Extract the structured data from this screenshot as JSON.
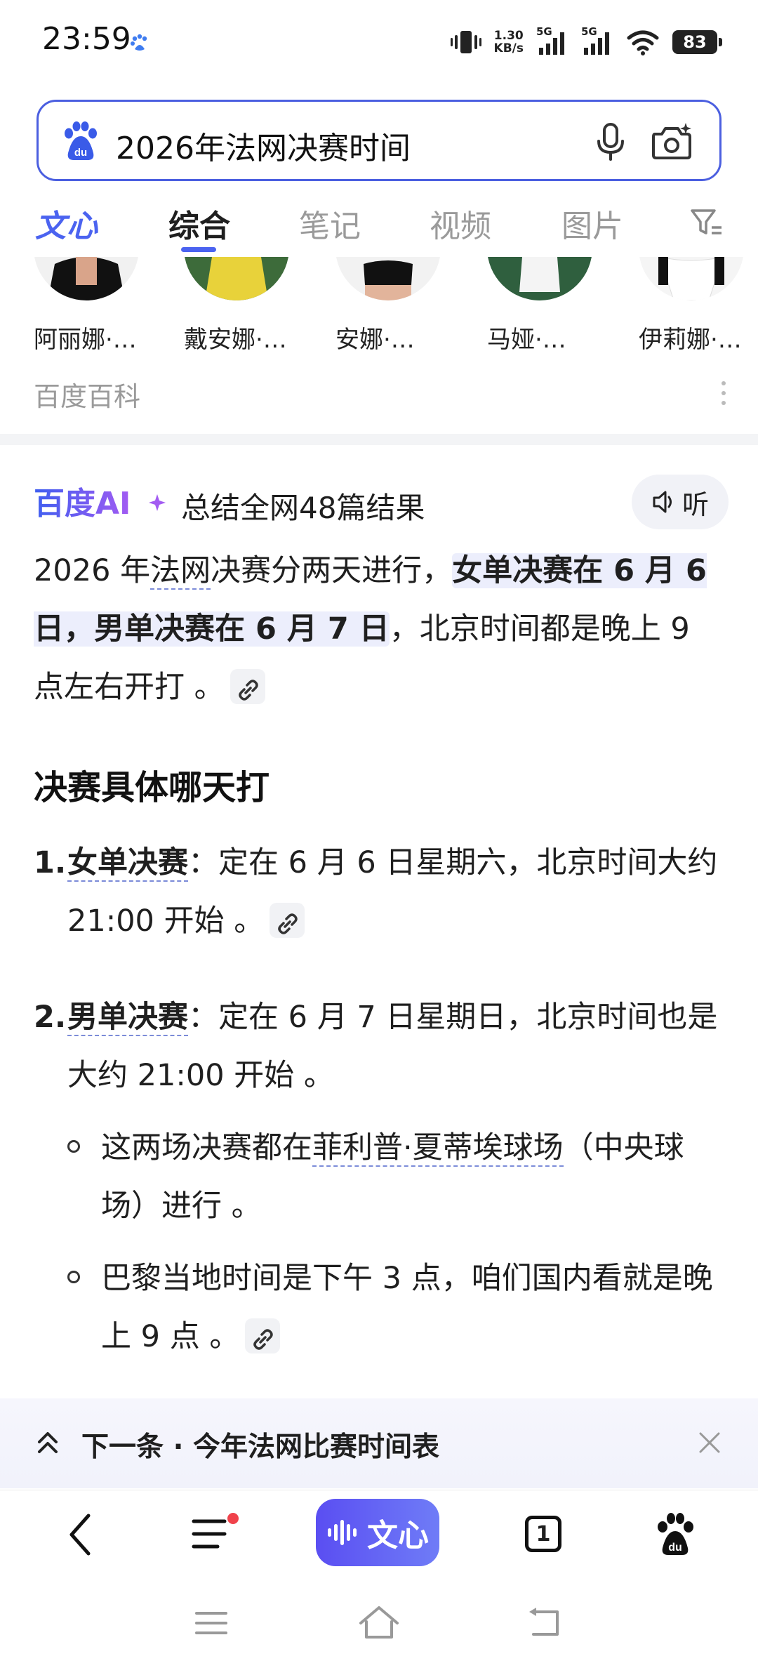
{
  "status_bar": {
    "time": "23:59",
    "net_speed_value": "1.30",
    "net_speed_unit": "KB/s",
    "signal1_label": "5G",
    "signal2_label": "5G",
    "battery_level": "83"
  },
  "search": {
    "query": "2026年法网决赛时间"
  },
  "tabs": [
    {
      "label": "文心"
    },
    {
      "label": "综合"
    },
    {
      "label": "笔记"
    },
    {
      "label": "视频"
    },
    {
      "label": "图片"
    }
  ],
  "persons": [
    {
      "name": "阿丽娜·…"
    },
    {
      "name": "戴安娜·…"
    },
    {
      "name": "安娜·…"
    },
    {
      "name": "马娅·…"
    },
    {
      "name": "伊莉娜·…"
    }
  ],
  "baike_label": "百度百科",
  "ai": {
    "logo_text": "百度AI",
    "summary": "总结全网48篇结果",
    "listen_label": "听",
    "intro": {
      "p1": "2026 年",
      "p2": "法网",
      "p3": "决赛分两天进行，",
      "p4": "女单决赛在 6 月 6 日，男单决赛在 6 月 7 日",
      "p5": "，北京时间都是晚上 9 点左右开打 。"
    },
    "heading": "决赛具体哪天打",
    "items": [
      {
        "num": "1.",
        "label": "女单决赛",
        "text": "：定在 6 月 6 日星期六，北京时间大约 21:00 开始 。"
      },
      {
        "num": "2.",
        "label": "男单决赛",
        "text": "：定在 6 月 7 日星期日，北京时间也是大约 21:00 开始 。"
      }
    ],
    "sub_items": [
      {
        "p1": "这两场决赛都在",
        "link": "菲利普·夏蒂埃球场",
        "p2": "（中央球场）进行 。"
      },
      {
        "text": "巴黎当地时间是下午 3 点，咱们国内看就是晚上 9 点 。"
      }
    ]
  },
  "next_bar": {
    "text": "下一条 · 今年法网比赛时间表"
  },
  "toolbar": {
    "wenxin_label": "文心",
    "tab_count": "1"
  }
}
